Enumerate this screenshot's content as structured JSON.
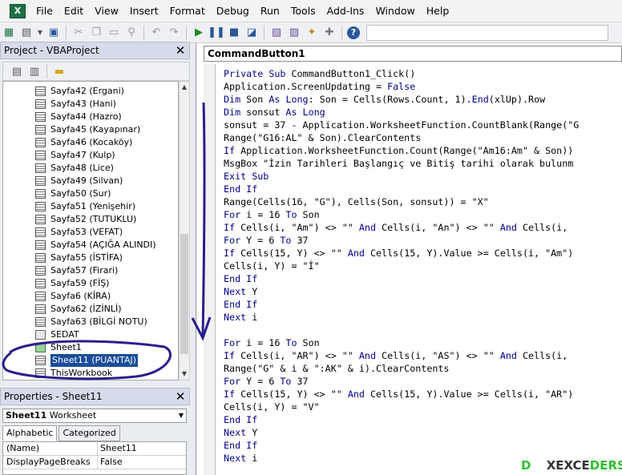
{
  "menu": [
    "File",
    "Edit",
    "View",
    "Insert",
    "Format",
    "Debug",
    "Run",
    "Tools",
    "Add-Ins",
    "Window",
    "Help"
  ],
  "project_panel": {
    "title": "Project - VBAProject"
  },
  "tree_items": [
    {
      "label": "Sayfa42 (Ergani)",
      "type": "sheet"
    },
    {
      "label": "Sayfa43 (Hani)",
      "type": "sheet"
    },
    {
      "label": "Sayfa44 (Hazro)",
      "type": "sheet"
    },
    {
      "label": "Sayfa45 (Kayapınar)",
      "type": "sheet"
    },
    {
      "label": "Sayfa46 (Kocaköy)",
      "type": "sheet"
    },
    {
      "label": "Sayfa47 (Kulp)",
      "type": "sheet"
    },
    {
      "label": "Sayfa48 (Lice)",
      "type": "sheet"
    },
    {
      "label": "Sayfa49 (Silvan)",
      "type": "sheet"
    },
    {
      "label": "Sayfa50 (Sur)",
      "type": "sheet"
    },
    {
      "label": "Sayfa51 (Yenişehir)",
      "type": "sheet"
    },
    {
      "label": "Sayfa52 (TUTUKLU)",
      "type": "sheet"
    },
    {
      "label": "Sayfa53 (VEFAT)",
      "type": "sheet"
    },
    {
      "label": "Sayfa54 (AÇIĞA ALINDI)",
      "type": "sheet"
    },
    {
      "label": "Sayfa55 (İSTİFA)",
      "type": "sheet"
    },
    {
      "label": "Sayfa57 (Firari)",
      "type": "sheet"
    },
    {
      "label": "Sayfa59 (FİŞ)",
      "type": "sheet"
    },
    {
      "label": "Sayfa6 (KİRA)",
      "type": "sheet"
    },
    {
      "label": "Sayfa62 (İZİNLİ)",
      "type": "sheet"
    },
    {
      "label": "Sayfa63 (BİLGİ NOTU)",
      "type": "sheet"
    },
    {
      "label": "SEDAT",
      "type": "form"
    },
    {
      "label": "Sheet1",
      "type": "workbook"
    },
    {
      "label": "Sheet11 (PUANTAJ)",
      "type": "sheet",
      "selected": true
    },
    {
      "label": "ThisWorkbook",
      "type": "sheet"
    }
  ],
  "properties_panel": {
    "title": "Properties - Sheet11",
    "object_name": "Sheet11",
    "object_type": "Worksheet",
    "tabs": [
      "Alphabetic",
      "Categorized"
    ],
    "rows": [
      {
        "key": "(Name)",
        "value": "Sheet11"
      },
      {
        "key": "DisplayPageBreaks",
        "value": "False"
      }
    ]
  },
  "code_window": {
    "object": "CommandButton1",
    "lines": [
      "Private Sub CommandButton1_Click()",
      "Application.ScreenUpdating = False",
      "Dim Son As Long: Son = Cells(Rows.Count, 1).End(xlUp).Row",
      "Dim sonsut As Long",
      "sonsut = 37 - Application.WorksheetFunction.CountBlank(Range(\"G",
      "Range(\"G16:AL\" & Son).ClearContents",
      "If Application.WorksheetFunction.Count(Range(\"Am16:Am\" & Son))",
      "MsgBox \"İzin Tarihleri Başlangıç ve Bitiş tarihi olarak bulunm",
      "Exit Sub",
      "End If",
      "Range(Cells(16, \"G\"), Cells(Son, sonsut)) = \"X\"",
      "For i = 16 To Son",
      "If Cells(i, \"Am\") <> \"\" And Cells(i, \"An\") <> \"\" And Cells(i,",
      "For Y = 6 To 37",
      "If Cells(15, Y) <> \"\" And Cells(15, Y).Value >= Cells(i, \"Am\")",
      "Cells(i, Y) = \"İ\"",
      "End If",
      "Next Y",
      "End If",
      "Next i",
      "",
      "For i = 16 To Son",
      "If Cells(i, \"AR\") <> \"\" And Cells(i, \"AS\") <> \"\" And Cells(i,",
      "Range(\"G\" & i & \":AK\" & i).ClearContents",
      "For Y = 6 To 37",
      "If Cells(15, Y) <> \"\" And Cells(15, Y).Value >= Cells(i, \"AR\")",
      "Cells(i, Y) = \"V\"",
      "End If",
      "Next Y",
      "End If",
      "Next i"
    ]
  },
  "watermark": {
    "part1": "D",
    "part2": "XEXCE",
    "part3": "DERS"
  },
  "colors": {
    "keyword": "#00008b",
    "selection": "#1a4d9a",
    "annotation": "#2a1e8c"
  }
}
